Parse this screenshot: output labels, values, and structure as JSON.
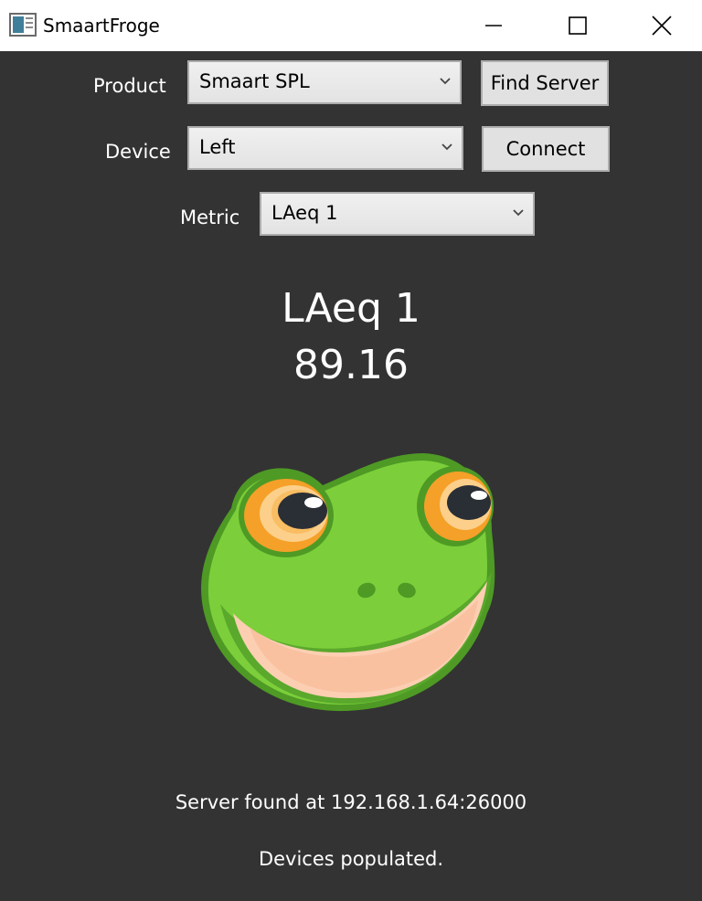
{
  "window": {
    "title": "SmaartFroge",
    "min_icon": "minimize-icon",
    "max_icon": "maximize-icon",
    "close_icon": "close-icon"
  },
  "form": {
    "product_label": "Product",
    "product_value": "Smaart SPL",
    "find_server_label": "Find Server",
    "device_label": "Device",
    "device_value": "Left",
    "connect_label": "Connect",
    "metric_label": "Metric",
    "metric_value": "LAeq 1"
  },
  "display": {
    "metric_name": "LAeq 1",
    "metric_value": "89.16",
    "image": "frog-face-image"
  },
  "status": {
    "line1": "Server found at 192.168.1.64:26000",
    "line2": "Devices populated."
  },
  "colors": {
    "background": "#333333",
    "text": "#ffffff",
    "frog_green": "#7ccf3a",
    "frog_dark_green": "#4e9a25",
    "frog_eye_orange": "#f5a028",
    "frog_mouth": "#fccfb2"
  }
}
